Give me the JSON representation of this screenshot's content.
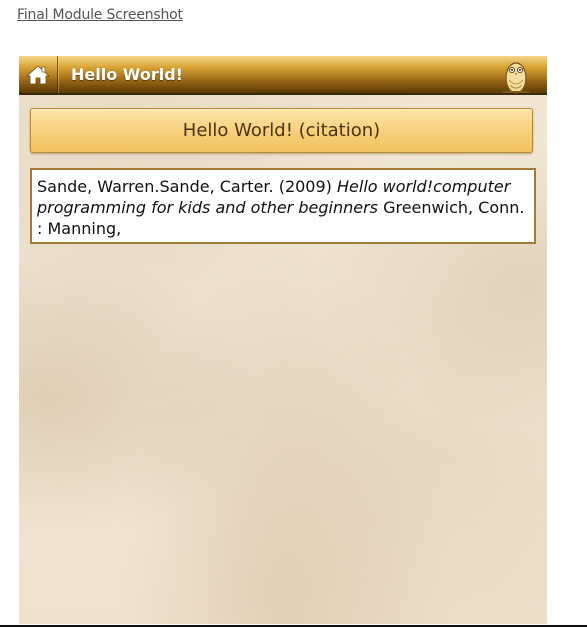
{
  "page": {
    "link_text": "Final Module Screenshot"
  },
  "header": {
    "title": "Hello World!",
    "home_icon": "home-icon",
    "logo_icon": "owl-icon"
  },
  "main": {
    "citation_button_label": "Hello World! (citation)",
    "citation": {
      "authors_year": "Sande, Warren.Sande, Carter. (2009)",
      "title": "Hello world!computer programming for kids and other beginners",
      "publisher": "Greenwich, Conn. : Manning,"
    }
  },
  "colors": {
    "header_gold": "#d9a434",
    "button_gold": "#f7cf7a",
    "parchment": "#f1e8d7",
    "citation_border": "#a47a3a"
  }
}
